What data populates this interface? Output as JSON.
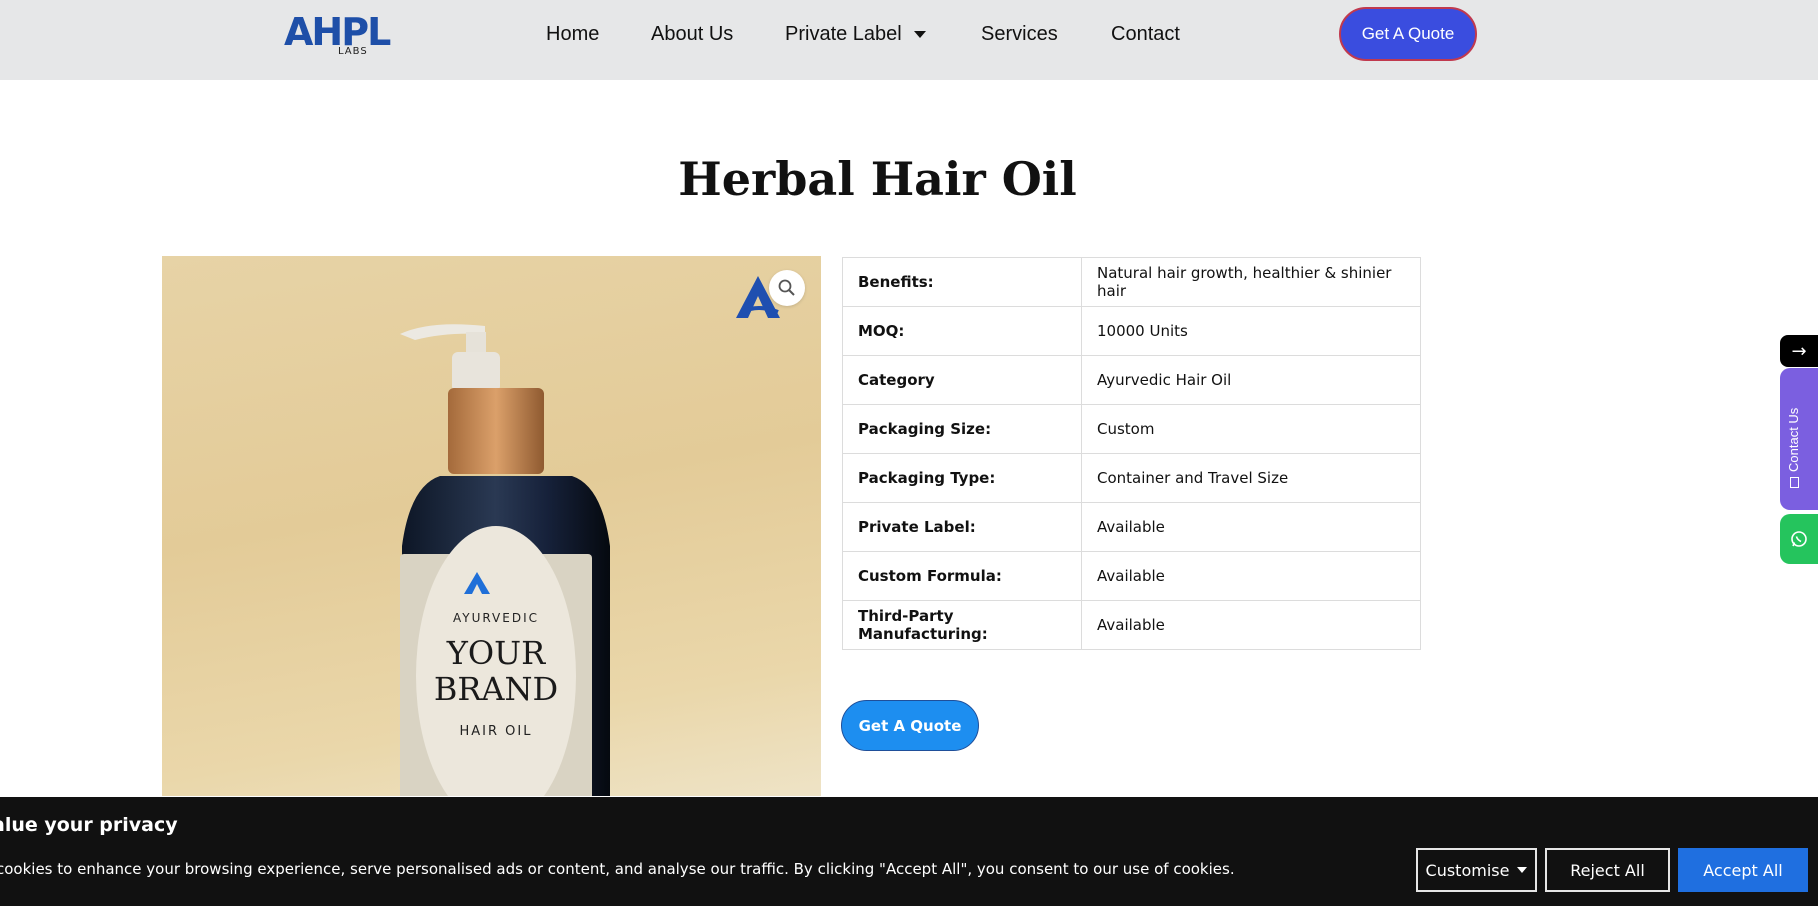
{
  "header": {
    "logo_text": "AHPL",
    "logo_sub": "LABS",
    "nav": [
      "Home",
      "About Us",
      "Private Label",
      "Services",
      "Contact"
    ],
    "cta": "Get A Quote"
  },
  "product": {
    "title": "Herbal Hair Oil",
    "image_label": {
      "line1": "AYURVEDIC",
      "line2": "YOUR",
      "line3": "BRAND",
      "line4": "HAIR OIL"
    },
    "specs": [
      {
        "label": "Benefits:",
        "value": "Natural hair growth, healthier &  shinier hair"
      },
      {
        "label": "MOQ:",
        "value": "10000 Units"
      },
      {
        "label": "Category",
        "value": "Ayurvedic Hair Oil"
      },
      {
        "label": "Packaging Size:",
        "value": "Custom"
      },
      {
        "label": "Packaging Type:",
        "value": "Container and Travel Size"
      },
      {
        "label": "Private Label:",
        "value": "Available"
      },
      {
        "label": "Custom Formula:",
        "value": "Available"
      },
      {
        "label": "Third-Party Manufacturing:",
        "value": "Available"
      }
    ],
    "cta": "Get A Quote"
  },
  "side": {
    "arrow": "→",
    "contact_label": "Contact Us"
  },
  "cookie": {
    "title": "alue your privacy",
    "text": "cookies to enhance your browsing experience, serve personalised ads or content, and analyse our traffic. By clicking \"Accept All\", you consent to our use of cookies.",
    "customise": "Customise",
    "reject": "Reject All",
    "accept": "Accept All"
  },
  "colors": {
    "header_bg": "#e6e7e8",
    "brand_blue": "#1e4fa8",
    "cta_top": "#3a4ddf",
    "cta_main": "#1d8ef0",
    "accept_btn": "#1f6fe0",
    "contact_tab": "#7b5fe0",
    "whatsapp_tab": "#25c45d"
  },
  "icons": {
    "zoom": "magnifier-icon",
    "dropdown": "chevron-down-icon",
    "email": "envelope-icon",
    "whatsapp": "whatsapp-icon"
  }
}
